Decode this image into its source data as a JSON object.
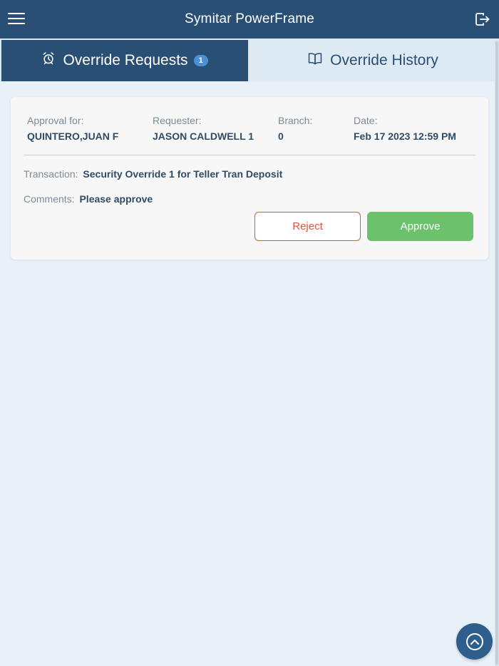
{
  "header": {
    "title": "Symitar PowerFrame",
    "menu_icon": "hamburger-menu-icon",
    "logout_icon": "logout-icon"
  },
  "tabs": [
    {
      "label": "Override Requests",
      "icon": "alarm-clock-icon",
      "badge": "1",
      "active": true
    },
    {
      "label": "Override History",
      "icon": "open-book-icon",
      "active": false
    }
  ],
  "request": {
    "approval_for_label": "Approval for:",
    "approval_for_value": "QUINTERO,JUAN F",
    "requester_label": "Requester:",
    "requester_value": "JASON CALDWELL 1",
    "branch_label": "Branch:",
    "branch_value": "0",
    "date_label": "Date:",
    "date_value": "Feb 17 2023 12:59 PM",
    "transaction_label": "Transaction:",
    "transaction_value": "Security Override 1 for Teller Tran Deposit",
    "comments_label": "Comments:",
    "comments_value": "Please approve",
    "reject_label": "Reject",
    "approve_label": "Approve"
  },
  "colors": {
    "header_bg": "#2a4f74",
    "reject": "#e0533c",
    "approve": "#6cc16c",
    "badge": "#4d8fd1"
  },
  "fab": {
    "icon": "scroll-to-top-icon"
  }
}
